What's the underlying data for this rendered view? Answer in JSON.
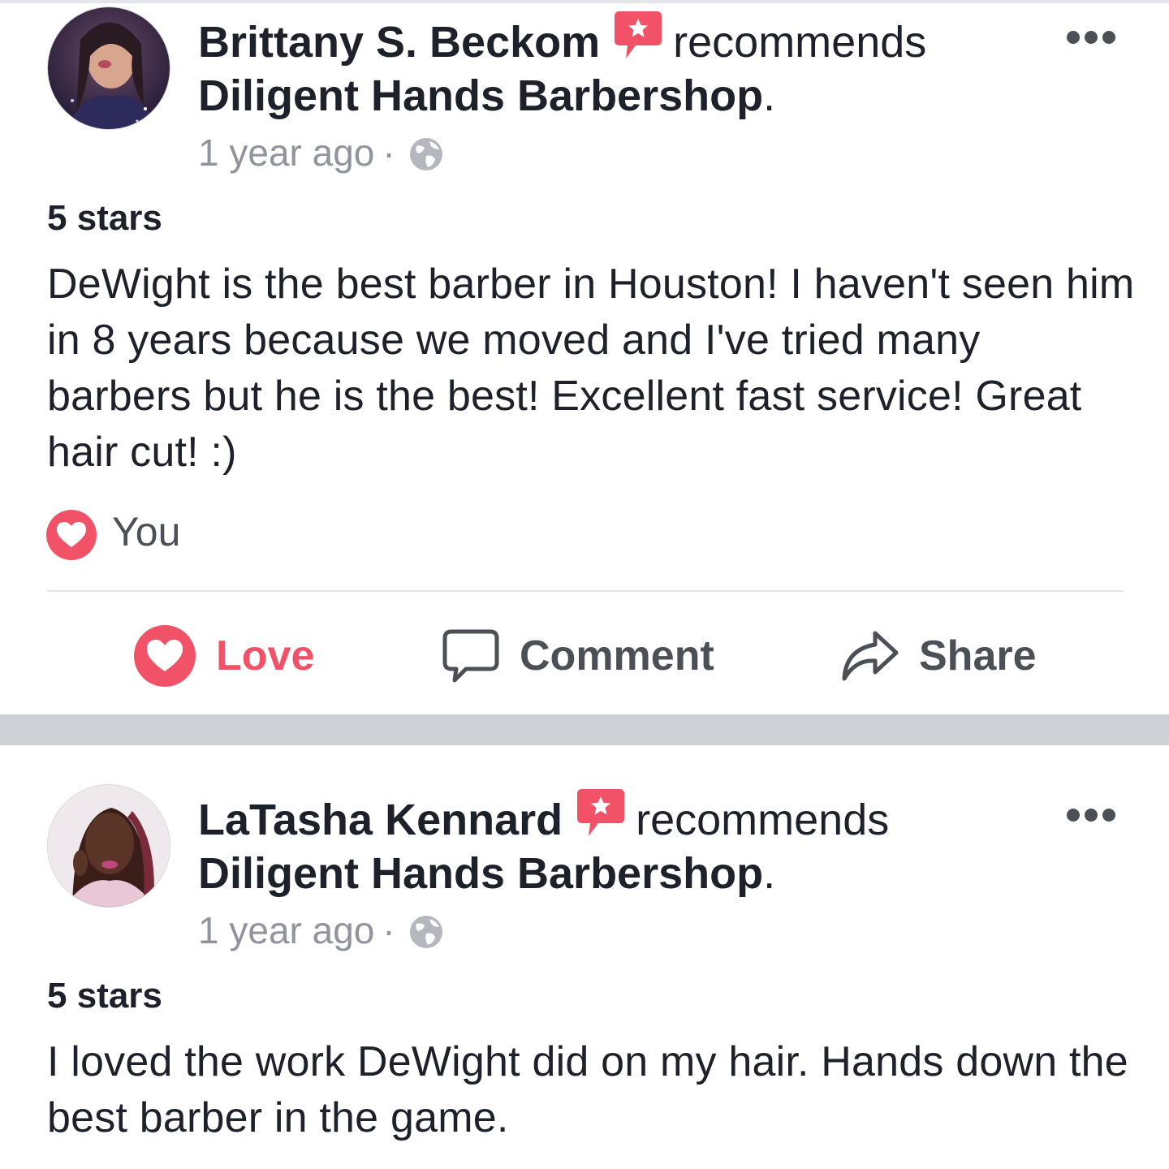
{
  "colors": {
    "love": "#f25268",
    "text_primary": "#1d2129",
    "text_secondary": "#90949c",
    "separator": "#cdd0d4"
  },
  "posts": [
    {
      "author": "Brittany S. Beckom",
      "verb": "recommends",
      "page": "Diligent Hands  Barbershop",
      "period": ".",
      "time": "1 year ago",
      "meta_dot": "·",
      "privacy_icon": "globe-icon",
      "rating": "5 stars",
      "body": "DeWight is the best barber in Houston! I haven't seen him in 8 years because we moved and I've tried many barbers but he is the best! Excellent fast service! Great hair cut! :)",
      "reactions_label": "You",
      "actions": {
        "love": "Love",
        "comment": "Comment",
        "share": "Share"
      }
    },
    {
      "author": "LaTasha Kennard",
      "verb": "recommends",
      "page": "Diligent Hands  Barbershop",
      "period": ".",
      "time": "1 year ago",
      "meta_dot": "·",
      "privacy_icon": "globe-icon",
      "rating": "5 stars",
      "body": "I loved the work DeWight did on my hair. Hands down the best barber in the game."
    }
  ]
}
